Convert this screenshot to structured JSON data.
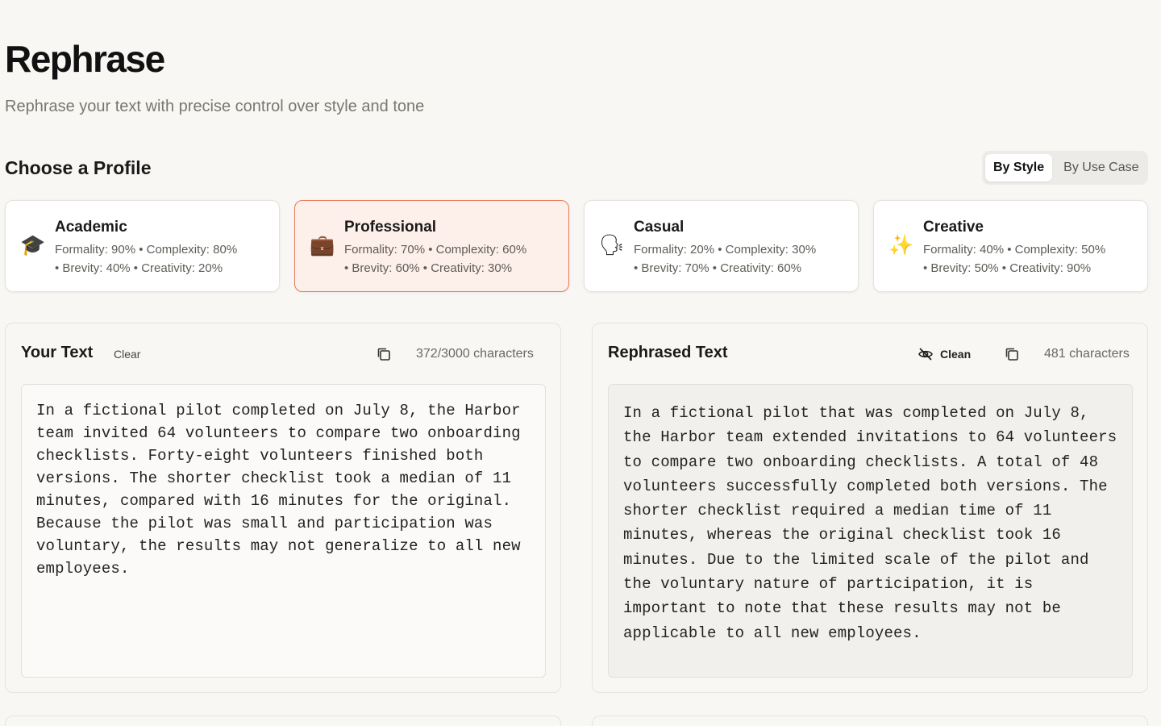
{
  "header": {
    "title": "Rephrase",
    "subtitle": "Rephrase your text with precise control over style and tone"
  },
  "profiles_section": {
    "title": "Choose a Profile",
    "toggle": {
      "options": [
        "By Style",
        "By Use Case"
      ],
      "selected": "By Style"
    }
  },
  "profiles": [
    {
      "name": "Academic",
      "icon": "graduation-cap-icon",
      "emoji": "🎓",
      "line1": "Formality: 90% • Complexity: 80%",
      "line2": "• Brevity: 40% • Creativity: 20%",
      "selected": false
    },
    {
      "name": "Professional",
      "icon": "briefcase-icon",
      "emoji": "💼",
      "line1": "Formality: 70% • Complexity: 60%",
      "line2": "• Brevity: 60% • Creativity: 30%",
      "selected": true
    },
    {
      "name": "Casual",
      "icon": "speaking-head-icon",
      "emoji": "🗣",
      "line1": "Formality: 20% • Complexity: 30%",
      "line2": "• Brevity: 70% • Creativity: 60%",
      "selected": false
    },
    {
      "name": "Creative",
      "icon": "sparkles-icon",
      "emoji": "✨",
      "line1": "Formality: 40% • Complexity: 50%",
      "line2": "• Brevity: 50% • Creativity: 90%",
      "selected": false
    }
  ],
  "input_panel": {
    "title": "Your Text",
    "clear_label": "Clear",
    "char_count": "372/3000 characters",
    "text": "In a fictional pilot completed on July 8, the Harbor team invited 64 volunteers to compare two onboarding checklists. Forty-eight volunteers finished both versions. The shorter checklist took a median of 11 minutes, compared with 16 minutes for the original. Because the pilot was small and participation was voluntary, the results may not generalize to all new employees."
  },
  "output_panel": {
    "title": "Rephrased Text",
    "clean_label": "Clean",
    "char_count": "481 characters",
    "text": "In a fictional pilot that was completed on July 8, the Harbor team extended invitations to 64 volunteers to compare two onboarding checklists. A total of 48 volunteers successfully completed both versions. The shorter checklist required a median time of 11 minutes, whereas the original checklist took 16 minutes. Due to the limited scale of the pilot and the voluntary nature of participation, it is important to note that these results may not be applicable to all new employees."
  },
  "colors": {
    "background": "#f8f7f4",
    "selected_card_bg": "#fdefe9",
    "selected_card_border": "#ea7b58"
  }
}
